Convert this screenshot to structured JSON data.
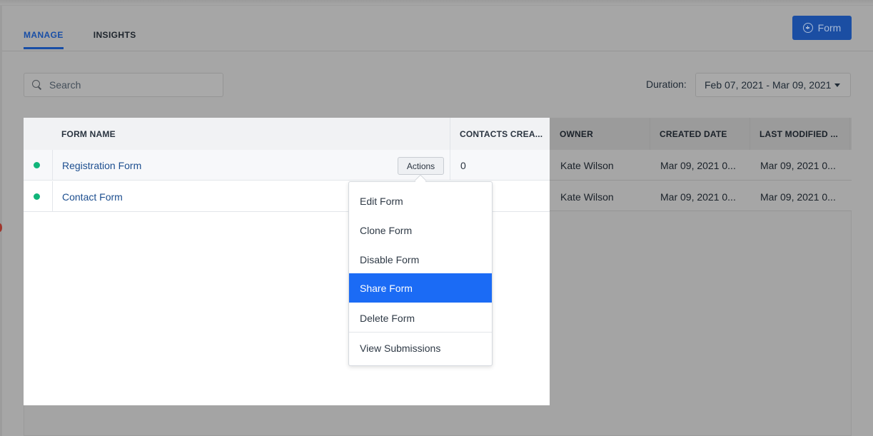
{
  "header": {
    "tabs": [
      {
        "label": "MANAGE",
        "active": true
      },
      {
        "label": "INSIGHTS",
        "active": false
      }
    ],
    "add_form_label": "Form"
  },
  "filters": {
    "search_placeholder": "Search",
    "duration_label": "Duration:",
    "duration_value": "Feb 07, 2021 - Mar 09, 2021"
  },
  "table": {
    "columns": [
      "FORM NAME",
      "CONTACTS CREA...",
      "OWNER",
      "CREATED DATE",
      "LAST MODIFIED ..."
    ],
    "rows": [
      {
        "status_color": "#11b57a",
        "name": "Registration Form",
        "contacts": "0",
        "owner": "Kate Wilson",
        "created": "Mar 09, 2021 0...",
        "modified": "Mar 09, 2021 0..."
      },
      {
        "status_color": "#11b57a",
        "name": "Contact Form",
        "contacts": "",
        "owner": "Kate Wilson",
        "created": "Mar 09, 2021 0...",
        "modified": "Mar 09, 2021 0..."
      }
    ],
    "actions_label": "Actions"
  },
  "actions_menu": {
    "items": [
      {
        "label": "Edit Form",
        "selected": false
      },
      {
        "label": "Clone Form",
        "selected": false
      },
      {
        "label": "Disable Form",
        "selected": false
      },
      {
        "label": "Share Form",
        "selected": true
      },
      {
        "label": "Delete Form",
        "selected": false
      },
      {
        "label": "View Submissions",
        "selected": false
      }
    ]
  },
  "colors": {
    "accent": "#1b6bf5",
    "active_tab": "#184ea6",
    "status_active": "#11b57a",
    "link": "#1c4e8f"
  }
}
